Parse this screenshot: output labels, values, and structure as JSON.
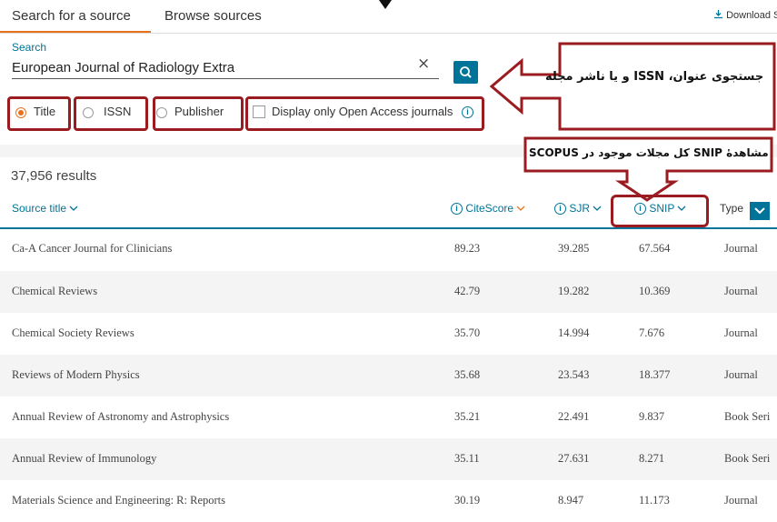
{
  "tabs": {
    "search": "Search for a source",
    "browse": "Browse sources"
  },
  "download": "Download Sco",
  "search": {
    "label": "Search",
    "value": "European Journal of Radiology Extra",
    "clear": "×"
  },
  "options": {
    "title": "Title",
    "issn": "ISSN",
    "publisher": "Publisher",
    "open_access": "Display only Open Access journals"
  },
  "annotations": {
    "search_note": "جستجوی عنوان، ISSN و یا ناشر مجله",
    "snip_note": "مشاهدهٔ SNIP کل مجلات موجود در SCOPUS"
  },
  "results_count": "37,956 results",
  "table": {
    "headers": {
      "source_title": "Source title",
      "citescore": "CiteScore",
      "sjr": "SJR",
      "snip": "SNIP",
      "type": "Type"
    },
    "rows": [
      {
        "title": "Ca-A Cancer Journal for Clinicians",
        "citescore": "89.23",
        "sjr": "39.285",
        "snip": "67.564",
        "type": "Journal"
      },
      {
        "title": "Chemical Reviews",
        "citescore": "42.79",
        "sjr": "19.282",
        "snip": "10.369",
        "type": "Journal"
      },
      {
        "title": "Chemical Society Reviews",
        "citescore": "35.70",
        "sjr": "14.994",
        "snip": "7.676",
        "type": "Journal"
      },
      {
        "title": "Reviews of Modern Physics",
        "citescore": "35.68",
        "sjr": "23.543",
        "snip": "18.377",
        "type": "Journal"
      },
      {
        "title": "Annual Review of Astronomy and Astrophysics",
        "citescore": "35.21",
        "sjr": "22.491",
        "snip": "9.837",
        "type": "Book Seri"
      },
      {
        "title": "Annual Review of Immunology",
        "citescore": "35.11",
        "sjr": "27.631",
        "snip": "8.271",
        "type": "Book Seri"
      },
      {
        "title": "Materials Science and Engineering: R: Reports",
        "citescore": "30.19",
        "sjr": "8.947",
        "snip": "11.173",
        "type": "Journal"
      }
    ]
  },
  "colors": {
    "accent": "#007398",
    "orange": "#e9711c",
    "annotation_red": "#9a1b20"
  }
}
